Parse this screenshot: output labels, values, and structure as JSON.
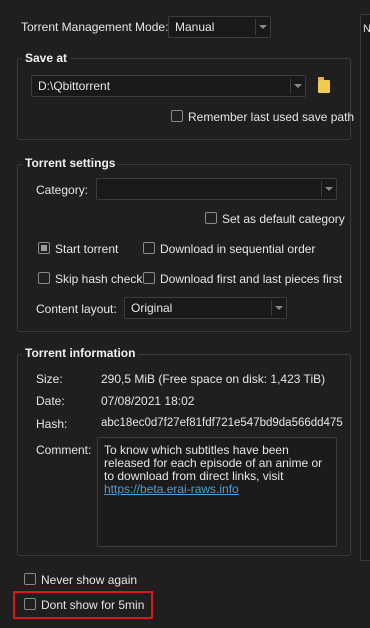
{
  "dialog": {
    "management_mode_label": "Torrent Management Mode:",
    "management_mode_value": "Manual"
  },
  "save_at": {
    "title": "Save at",
    "path": "D:\\Qbittorrent",
    "remember_label": "Remember last used save path",
    "remember_checked": false
  },
  "torrent_settings": {
    "title": "Torrent settings",
    "category_label": "Category:",
    "category_value": "",
    "default_category_label": "Set as default category",
    "start_torrent_label": "Start torrent",
    "start_torrent_checked": true,
    "sequential_label": "Download in sequential order",
    "skip_hash_label": "Skip hash check",
    "first_last_label": "Download first and last pieces first",
    "content_layout_label": "Content layout:",
    "content_layout_value": "Original"
  },
  "torrent_info": {
    "title": "Torrent information",
    "size_label": "Size:",
    "size_value": "290,5 MiB (Free space on disk: 1,423 TiB)",
    "date_label": "Date:",
    "date_value": "07/08/2021 18:02",
    "hash_label": "Hash:",
    "hash_value": "abc18ec0d7f27ef81fdf721e547bd9da566dd475",
    "comment_label": "Comment:",
    "comment_text": "To know which subtitles have been released for each episode of an anime or to download from direct links, visit ",
    "comment_link": "https://beta.erai-raws.info"
  },
  "footer": {
    "never_show_label": "Never show again",
    "dont_show_label": "Dont show for 5min"
  },
  "right_panel_fragment": "N",
  "colors": {
    "background": "#1f1f1f",
    "border": "#3b3b3b",
    "link": "#4a9fe0",
    "highlight": "#e0141e",
    "folder": "#f2cc51"
  }
}
